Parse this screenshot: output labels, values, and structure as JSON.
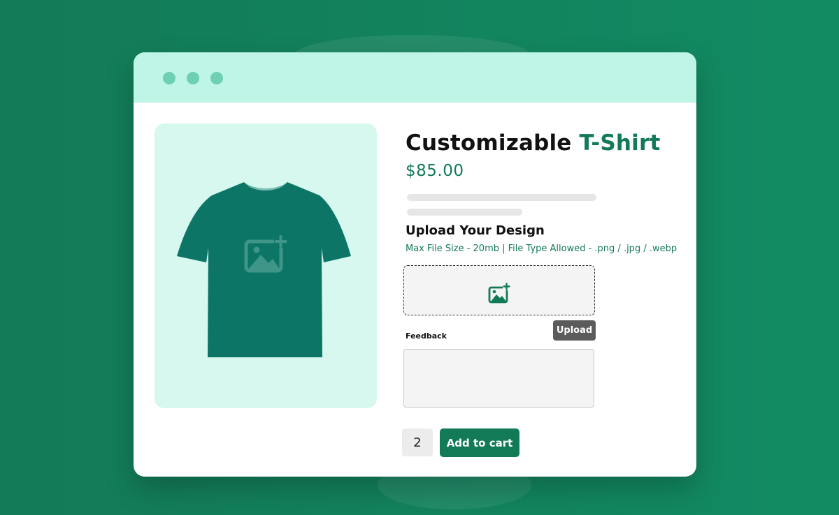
{
  "colors": {
    "background": "#137a57",
    "accent": "#137a57",
    "titlebar": "#bff5e6",
    "window_dots": "#6fcfb5",
    "image_panel": "#d6f8ee",
    "tshirt": "#0c7566",
    "upload_button": "#5b5b5b"
  },
  "window": {
    "controls": [
      "window-dot",
      "window-dot",
      "window-dot"
    ]
  },
  "product": {
    "title_main": "Customizable",
    "title_accent": "T-Shirt",
    "price": "$85.00",
    "image_icon": "tshirt-icon",
    "image_placeholder_icon": "image-add-icon"
  },
  "upload": {
    "heading": "Upload Your Design",
    "hint": "Max File Size - 20mb | File Type Allowed - .png / .jpg / .webp",
    "dropzone_icon": "image-add-icon",
    "button_label": "Upload"
  },
  "feedback": {
    "label": "Feedback",
    "value": ""
  },
  "cart": {
    "quantity": "2",
    "add_label": "Add to cart"
  }
}
